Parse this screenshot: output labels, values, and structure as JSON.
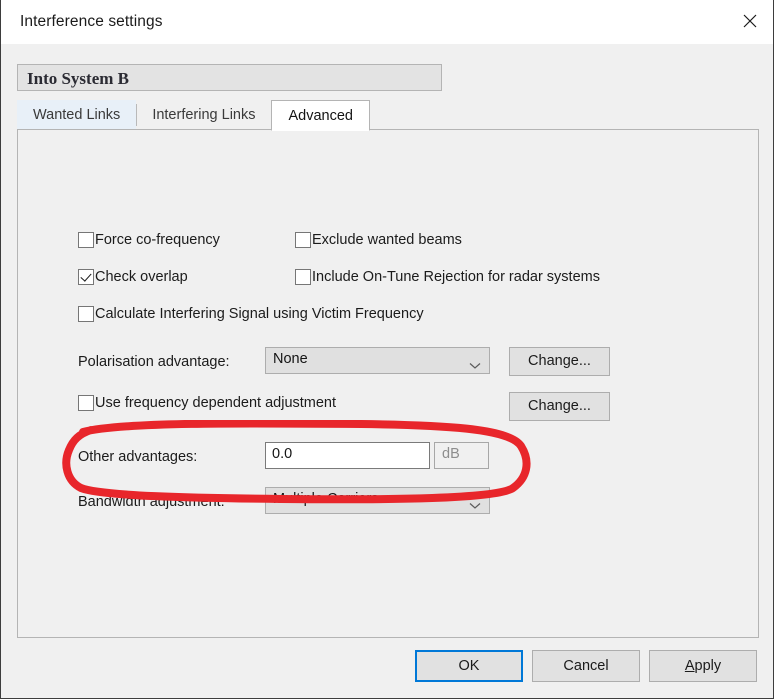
{
  "window": {
    "title": "Interference settings",
    "close_icon": "close-icon"
  },
  "group": {
    "header": "Into System B"
  },
  "tabs": [
    {
      "label": "Wanted Links",
      "active": false
    },
    {
      "label": "Interfering Links",
      "active": false
    },
    {
      "label": "Advanced",
      "active": true
    }
  ],
  "advanced": {
    "checkboxes": [
      {
        "label": "Force co-frequency",
        "checked": false
      },
      {
        "label": "Exclude wanted beams",
        "checked": false
      },
      {
        "label": "Check overlap",
        "checked": true
      },
      {
        "label": "Include On-Tune Rejection for radar systems",
        "checked": false
      },
      {
        "label": "Calculate Interfering Signal using Victim Frequency",
        "checked": false
      },
      {
        "label": "Use frequency dependent adjustment",
        "checked": false
      }
    ],
    "polarisation": {
      "label": "Polarisation advantage:",
      "value": "None",
      "change_button": "Change..."
    },
    "frequency_dependent": {
      "change_button": "Change..."
    },
    "other_advantages": {
      "label": "Other advantages:",
      "value": "0.0",
      "unit": "dB"
    },
    "bandwidth": {
      "label": "Bandwidth adjustment:",
      "value": "Multiple Carriers"
    }
  },
  "footer": {
    "ok": "OK",
    "cancel": "Cancel",
    "apply_prefix": "A",
    "apply_rest": "pply"
  },
  "annotation": {
    "color": "#e8262b",
    "shape": "ellipse-highlight"
  }
}
